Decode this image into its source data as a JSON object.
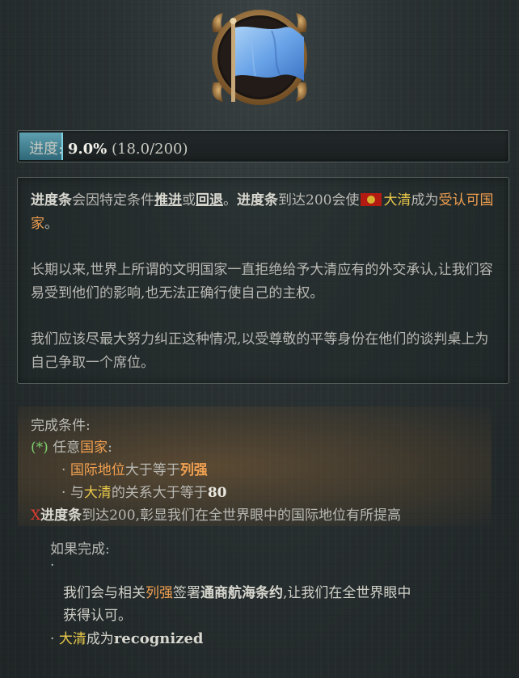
{
  "progress": {
    "label": "进度:",
    "percent": "9.0%",
    "detail": "(18.0/200)",
    "fill_fraction": 0.09
  },
  "description": {
    "p1": {
      "t1": "进度条",
      "t2": "会因特定条件",
      "t3": "推进",
      "t4": "或",
      "t5": "回退",
      "t6": "。",
      "t7": "进度条",
      "t8": "到达200会使",
      "t9": "大清",
      "t10": "成为",
      "t11": "受认可国家",
      "t12": "。"
    },
    "p2": "长期以来,世界上所谓的文明国家一直拒绝给予大清应有的外交承认,让我们容易受到他们的影响,也无法正确行使自己的主权。",
    "p3": "我们应该尽最大努力纠正这种情况,以受尊敬的平等身份在他们的谈判桌上为自己争取一个席位。"
  },
  "conditions": {
    "header": "完成条件:",
    "any_mark": "(*)",
    "any_label_1": "任意",
    "any_label_2": "国家",
    "any_label_3": ":",
    "c1_bullet": "·",
    "c1_a": "国际地位",
    "c1_b": "大于等于",
    "c1_c": "列强",
    "c2_bullet": "·",
    "c2_a": "与",
    "c2_b": "大清",
    "c2_c": "的关系大于等于",
    "c2_d": "80",
    "fail_mark": "X",
    "fail_a": "进度条",
    "fail_b": "到达200,彰显我们在全世界眼中的国际地位有所提高"
  },
  "effects": {
    "header": "如果完成:",
    "bullet": "·",
    "e1_a": "我们会与相关",
    "e1_b": "列强",
    "e1_c": "签署",
    "e1_d": "通商航海条约",
    "e1_e": ",让我们在全世界眼中",
    "e1_line2": "获得认可。",
    "e2_bullet": "·",
    "e2_a": "大清",
    "e2_b": "成为",
    "e2_c": "recognized"
  },
  "colors": {
    "accent_gold": "#e8c84a",
    "accent_orange": "#f0a050",
    "progress_fill": "#4f8ea0",
    "condition_ok": "#7fd26f",
    "condition_fail": "#e03c30"
  },
  "icons": {
    "emblem": "blue-flag-icon",
    "country_flag": "qing-flag-icon"
  }
}
